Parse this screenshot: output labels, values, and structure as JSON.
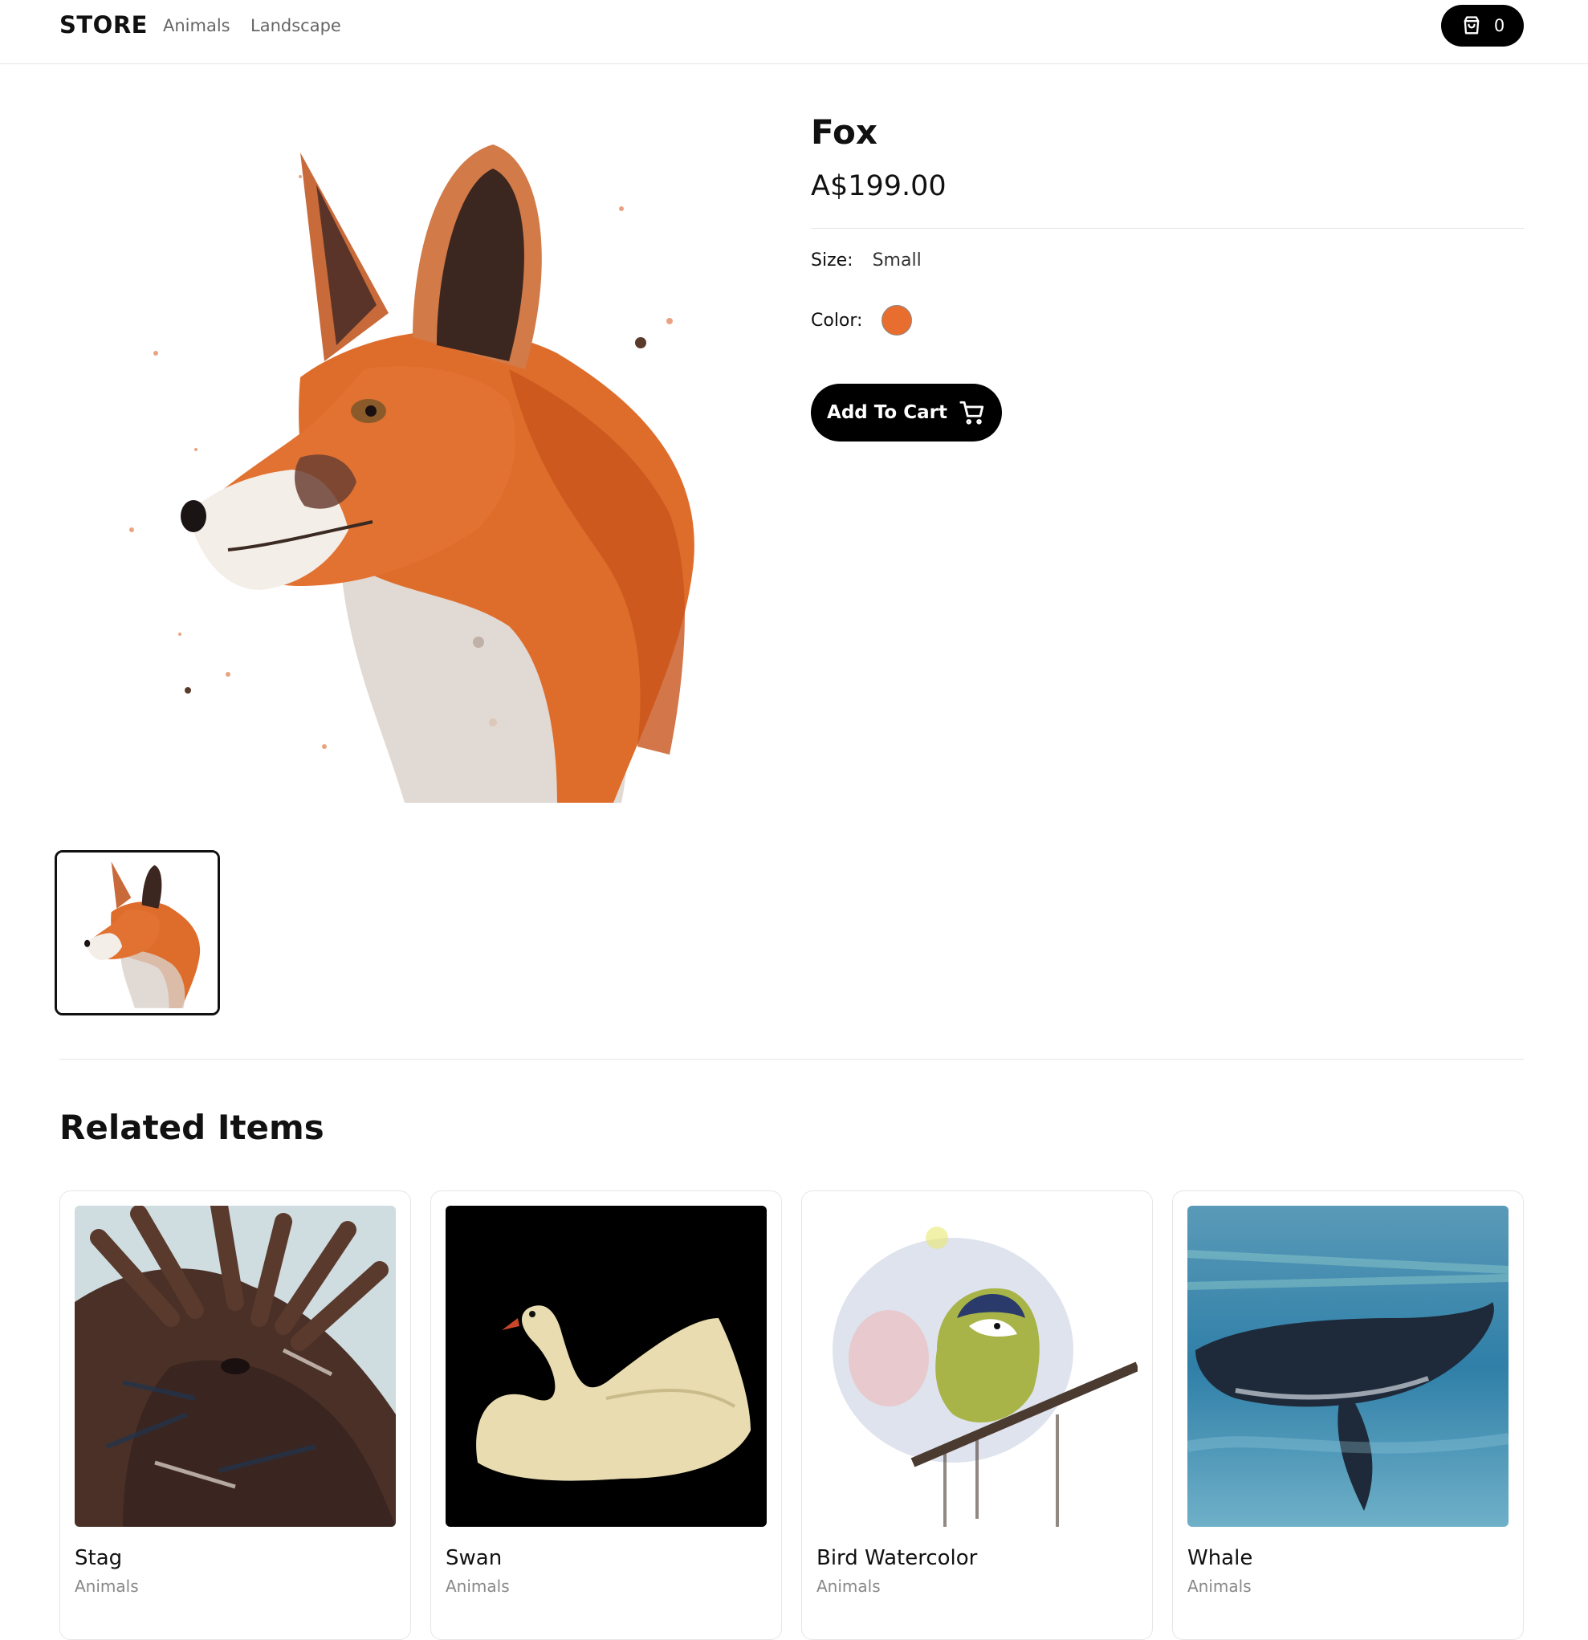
{
  "header": {
    "logo": "STORE",
    "nav": [
      {
        "label": "Animals"
      },
      {
        "label": "Landscape"
      }
    ],
    "cart_count": "0",
    "cart_icon": "shopping-bag-icon"
  },
  "product": {
    "title": "Fox",
    "price": "A$199.00",
    "size_label": "Size:",
    "size_value": "Small",
    "color_label": "Color:",
    "color_value": "#e86e2f",
    "add_to_cart_label": "Add To Cart",
    "add_to_cart_icon": "shopping-cart-icon"
  },
  "related": {
    "title": "Related Items",
    "items": [
      {
        "name": "Stag",
        "category": "Animals"
      },
      {
        "name": "Swan",
        "category": "Animals"
      },
      {
        "name": "Bird Watercolor",
        "category": "Animals"
      },
      {
        "name": "Whale",
        "category": "Animals"
      }
    ]
  },
  "colors": {
    "accent": "#000000",
    "fox_orange": "#e86e2f",
    "divider": "#e6e6e6"
  }
}
